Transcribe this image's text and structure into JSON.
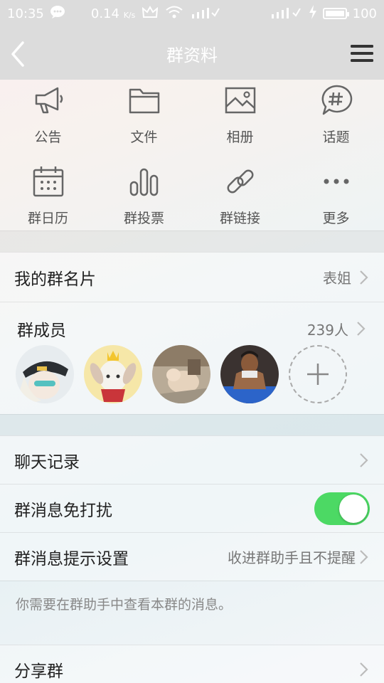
{
  "status_bar": {
    "time": "10:35",
    "speed": "0.14",
    "speed_unit": "K/s",
    "battery": "100"
  },
  "nav": {
    "title": "群资料"
  },
  "grid": {
    "announcement": "公告",
    "files": "文件",
    "album": "相册",
    "topics": "话题",
    "calendar": "群日历",
    "vote": "群投票",
    "link": "群链接",
    "more": "更多"
  },
  "card": {
    "label": "我的群名片",
    "value": "表姐"
  },
  "members": {
    "label": "群成员",
    "count": "239人"
  },
  "chat_history": {
    "label": "聊天记录"
  },
  "mute": {
    "label": "群消息免打扰",
    "enabled": true
  },
  "notify": {
    "label": "群消息提示设置",
    "value": "收进群助手且不提醒"
  },
  "hint": {
    "text": "你需要在群助手中查看本群的消息。"
  },
  "share": {
    "label": "分享群"
  },
  "colors": {
    "toggle_on": "#4cd964",
    "nav_bg": "#dcdcdc"
  }
}
